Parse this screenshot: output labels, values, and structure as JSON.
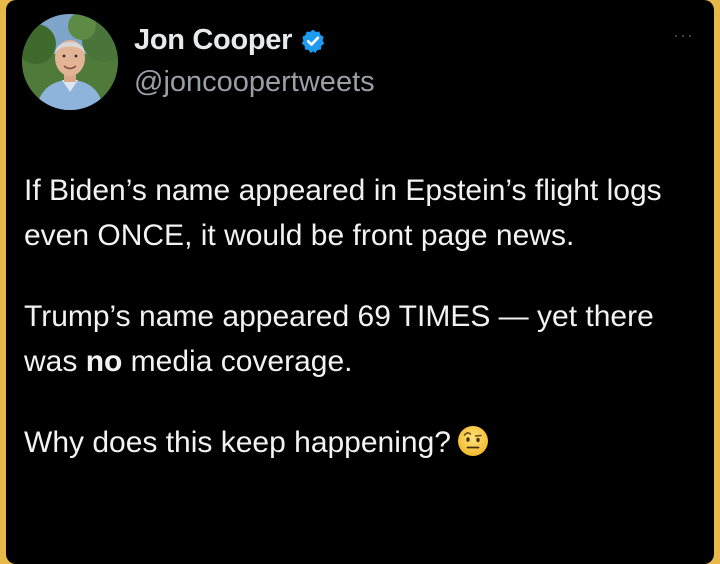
{
  "author": {
    "display_name": "Jon Cooper",
    "handle": "@joncoopertweets",
    "verified": true,
    "verified_color": "#1d9bf0"
  },
  "more_menu": {
    "icon": "more-horizontal-icon",
    "label": "···"
  },
  "tweet": {
    "p1": "If Biden’s name appeared in Epstein’s flight logs even ONCE, it would be front page news.",
    "p2_a": "Trump’s name appeared 69 TIMES — yet there was ",
    "p2_bold": "no",
    "p2_b": " media coverage.",
    "p3": "Why does this keep happening?",
    "p3_emoji": "raised-eyebrow-emoji"
  },
  "colors": {
    "background": "#000000",
    "border": "#e8b84a",
    "text": "#f2f2f2",
    "secondary_text": "#9a9fa4"
  }
}
